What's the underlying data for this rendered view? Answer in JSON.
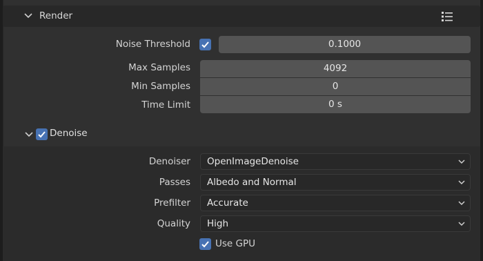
{
  "panel": {
    "title": "Render",
    "header_icons": [
      "chevron-down-icon",
      "list-menu-icon"
    ]
  },
  "noise_threshold": {
    "label": "Noise Threshold",
    "checked": true,
    "value": "0.1000"
  },
  "samples": {
    "max_label": "Max Samples",
    "max_value": "4092",
    "min_label": "Min Samples",
    "min_value": "0",
    "time_label": "Time Limit",
    "time_value": "0 s"
  },
  "denoise": {
    "title": "Denoise",
    "checked": true,
    "denoiser_label": "Denoiser",
    "denoiser_value": "OpenImageDenoise",
    "passes_label": "Passes",
    "passes_value": "Albedo and Normal",
    "prefilter_label": "Prefilter",
    "prefilter_value": "Accurate",
    "quality_label": "Quality",
    "quality_value": "High",
    "use_gpu_label": "Use GPU",
    "use_gpu_checked": true
  },
  "colors": {
    "accent": "#4772b3",
    "field": "#545454",
    "dropdown": "#282828",
    "panel_bg": "#303030"
  }
}
